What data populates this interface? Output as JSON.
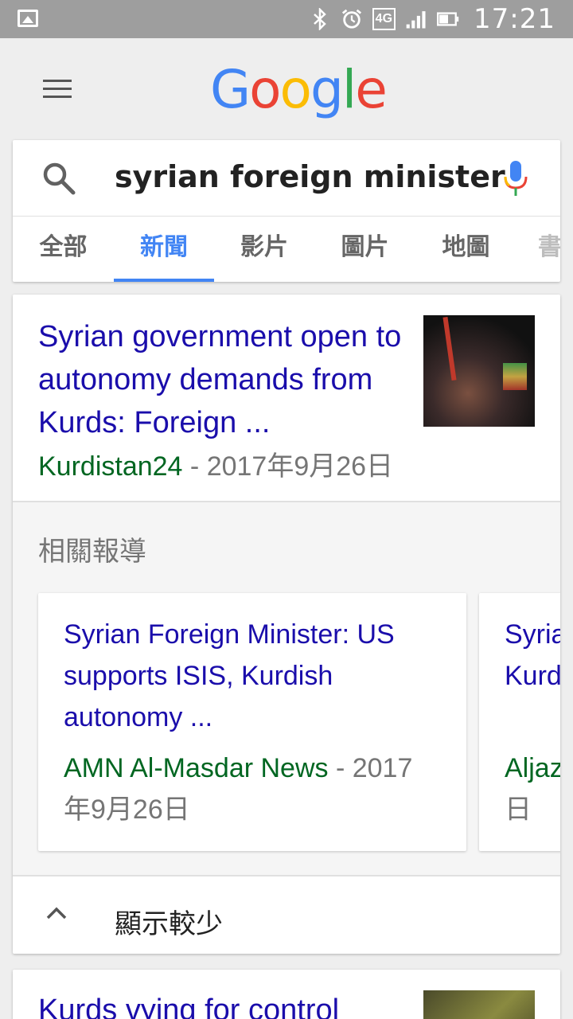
{
  "status_bar": {
    "time": "17:21",
    "network": "4G",
    "icons": [
      "image-notification-icon",
      "bluetooth-icon",
      "alarm-icon",
      "network-4g-icon",
      "signal-icon",
      "battery-icon"
    ]
  },
  "header": {
    "logo_text": [
      "G",
      "o",
      "o",
      "g",
      "l",
      "e"
    ],
    "menu_icon": "hamburger-menu-icon"
  },
  "search": {
    "query": "syrian foreign minister",
    "search_icon": "search-icon",
    "mic_icon": "microphone-icon"
  },
  "tabs": [
    {
      "label": "全部",
      "active": false
    },
    {
      "label": "新聞",
      "active": true
    },
    {
      "label": "影片",
      "active": false
    },
    {
      "label": "圖片",
      "active": false
    },
    {
      "label": "地圖",
      "active": false
    },
    {
      "label": "書",
      "active": false
    }
  ],
  "top_story": {
    "title": "Syrian government open to autonomy demands from Kurds: Foreign ...",
    "source": "Kurdistan24",
    "separator": " - ",
    "date": "2017年9月26日"
  },
  "related": {
    "heading": "相關報導",
    "cards": [
      {
        "title": "Syrian Foreign Minister: US supports ISIS, Kurdish autonomy ...",
        "source": "AMN Al-Masdar News",
        "separator": " - ",
        "date": "2017年9月26日"
      },
      {
        "title": "Syria Kurds",
        "source": "Aljaze",
        "separator": "",
        "date": "日"
      }
    ]
  },
  "show_less": {
    "label": "顯示較少",
    "icon": "chevron-up-icon"
  },
  "second_story": {
    "title": "Kurds vying for control"
  },
  "colors": {
    "link": "#1a0dab",
    "source": "#006621",
    "accent": "#4285f4",
    "status_bar": "#9e9e9e"
  }
}
